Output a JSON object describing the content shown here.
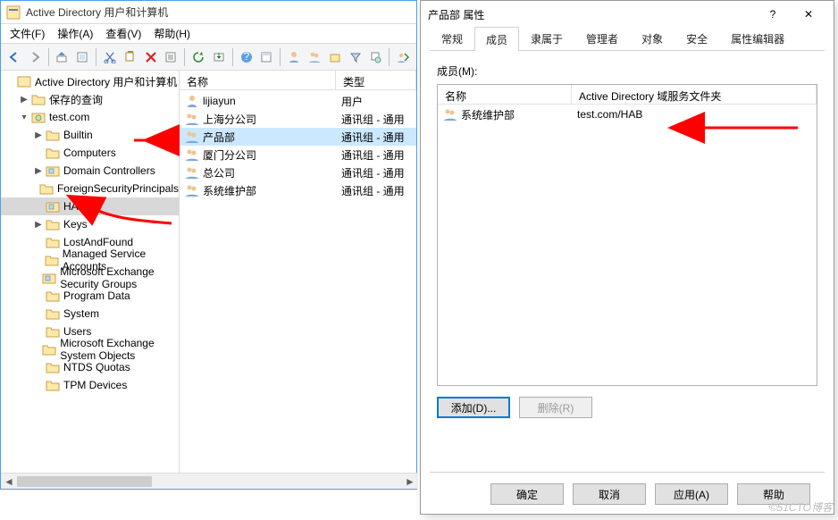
{
  "window": {
    "title": "Active Directory 用户和计算机",
    "menu": [
      "文件(F)",
      "操作(A)",
      "查看(V)",
      "帮助(H)"
    ]
  },
  "tree": {
    "root": "Active Directory 用户和计算机",
    "nodes": [
      {
        "label": "保存的查询",
        "expand": "▶",
        "icon": "folder"
      },
      {
        "label": "test.com",
        "expand": "▾",
        "icon": "domain",
        "children": [
          {
            "label": "Builtin",
            "expand": "▶",
            "icon": "folder"
          },
          {
            "label": "Computers",
            "icon": "folder"
          },
          {
            "label": "Domain Controllers",
            "expand": "▶",
            "icon": "ou"
          },
          {
            "label": "ForeignSecurityPrincipals",
            "icon": "folder"
          },
          {
            "label": "HAB",
            "icon": "ou",
            "selected": true
          },
          {
            "label": "Keys",
            "expand": "▶",
            "icon": "folder"
          },
          {
            "label": "LostAndFound",
            "icon": "folder"
          },
          {
            "label": "Managed Service Accounts",
            "icon": "folder"
          },
          {
            "label": "Microsoft Exchange Security Groups",
            "icon": "ou"
          },
          {
            "label": "Program Data",
            "icon": "folder"
          },
          {
            "label": "System",
            "icon": "folder"
          },
          {
            "label": "Users",
            "icon": "folder"
          },
          {
            "label": "Microsoft Exchange System Objects",
            "icon": "folder"
          },
          {
            "label": "NTDS Quotas",
            "icon": "folder"
          },
          {
            "label": "TPM Devices",
            "icon": "folder"
          }
        ]
      }
    ]
  },
  "list": {
    "headers": {
      "name": "名称",
      "type": "类型"
    },
    "rows": [
      {
        "name": "lijiayun",
        "type": "用户",
        "icon": "user"
      },
      {
        "name": "上海分公司",
        "type": "通讯组 - 通用",
        "icon": "group"
      },
      {
        "name": "产品部",
        "type": "通讯组 - 通用",
        "icon": "group",
        "selected": true
      },
      {
        "name": "厦门分公司",
        "type": "通讯组 - 通用",
        "icon": "group"
      },
      {
        "name": "总公司",
        "type": "通讯组 - 通用",
        "icon": "group"
      },
      {
        "name": "系统维护部",
        "type": "通讯组 - 通用",
        "icon": "group"
      }
    ]
  },
  "dialog": {
    "title": "产品部 属性",
    "help_symbol": "?",
    "close_symbol": "✕",
    "tabs": [
      "常规",
      "成员",
      "隶属于",
      "管理者",
      "对象",
      "安全",
      "属性编辑器"
    ],
    "active_tab_index": 1,
    "members_label": "成员(M):",
    "headers": {
      "name": "名称",
      "path": "Active Directory 域服务文件夹"
    },
    "rows": [
      {
        "name": "系统维护部",
        "path": "test.com/HAB",
        "icon": "group"
      }
    ],
    "buttons": {
      "add": "添加(D)...",
      "remove": "删除(R)",
      "ok": "确定",
      "cancel": "取消",
      "apply": "应用(A)",
      "help": "帮助"
    }
  },
  "watermark": "©51CTO博客"
}
